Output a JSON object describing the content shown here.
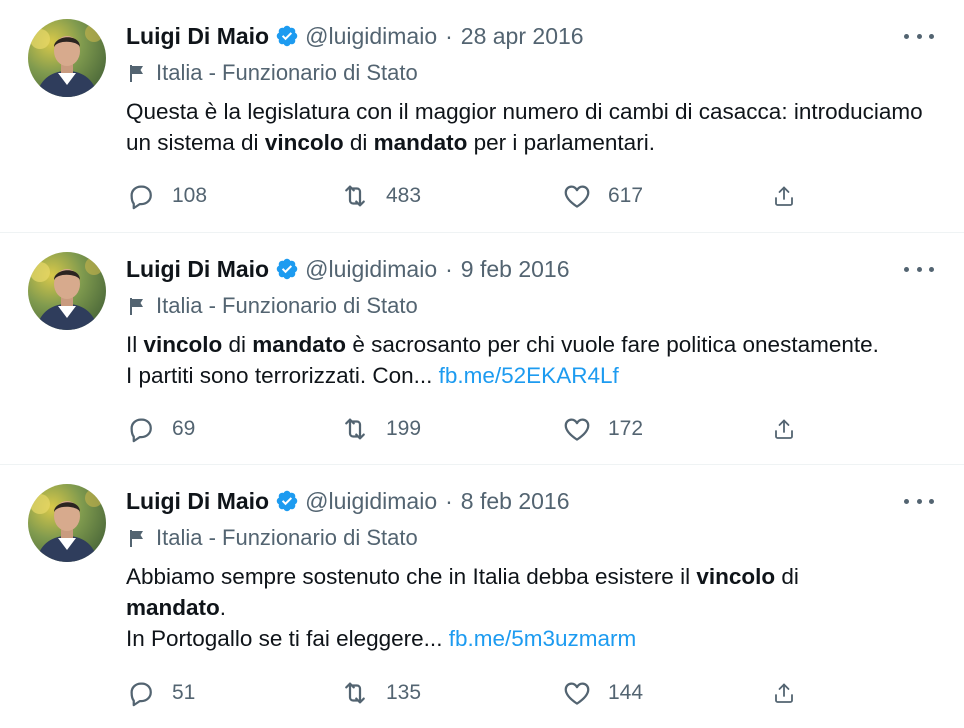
{
  "colors": {
    "text": "#0f1419",
    "secondary": "#536471",
    "link": "#1d9bf0",
    "verified": "#1d9bf0",
    "divider": "#eff3f4"
  },
  "tweets": [
    {
      "name": "Luigi Di Maio",
      "handle": "@luigidimaio",
      "dot": "·",
      "date": "28 apr 2016",
      "label": "Italia - Funzionario di Stato",
      "text": [
        {
          "t": "Questa è la legislatura con il maggior numero di cambi di casacca: introduciamo un sistema di ",
          "s": "normal"
        },
        {
          "t": "vincolo",
          "s": "bold"
        },
        {
          "t": " di ",
          "s": "normal"
        },
        {
          "t": "mandato",
          "s": "bold"
        },
        {
          "t": " per i parlamentari.",
          "s": "normal"
        }
      ],
      "replies": "108",
      "retweets": "483",
      "likes": "617"
    },
    {
      "name": "Luigi Di Maio",
      "handle": "@luigidimaio",
      "dot": "·",
      "date": "9 feb 2016",
      "label": "Italia - Funzionario di Stato",
      "text": [
        {
          "t": "Il ",
          "s": "normal"
        },
        {
          "t": "vincolo",
          "s": "bold"
        },
        {
          "t": " di ",
          "s": "normal"
        },
        {
          "t": "mandato",
          "s": "bold"
        },
        {
          "t": " è sacrosanto per chi vuole fare politica onestamente.",
          "s": "normal"
        },
        {
          "t": "",
          "s": "br"
        },
        {
          "t": "I partiti sono terrorizzati. Con... ",
          "s": "normal"
        },
        {
          "t": "fb.me/52EKAR4Lf",
          "s": "link"
        }
      ],
      "replies": "69",
      "retweets": "199",
      "likes": "172"
    },
    {
      "name": "Luigi Di Maio",
      "handle": "@luigidimaio",
      "dot": "·",
      "date": "8 feb 2016",
      "label": "Italia - Funzionario di Stato",
      "text": [
        {
          "t": "Abbiamo sempre sostenuto che in Italia debba esistere il ",
          "s": "normal"
        },
        {
          "t": "vincolo",
          "s": "bold"
        },
        {
          "t": " di ",
          "s": "normal"
        },
        {
          "t": "",
          "s": "br"
        },
        {
          "t": "mandato",
          "s": "bold"
        },
        {
          "t": ".",
          "s": "normal"
        },
        {
          "t": "",
          "s": "br"
        },
        {
          "t": "In Portogallo se ti fai eleggere... ",
          "s": "normal"
        },
        {
          "t": "fb.me/5m3uzmarm",
          "s": "link"
        }
      ],
      "replies": "51",
      "retweets": "135",
      "likes": "144"
    }
  ]
}
